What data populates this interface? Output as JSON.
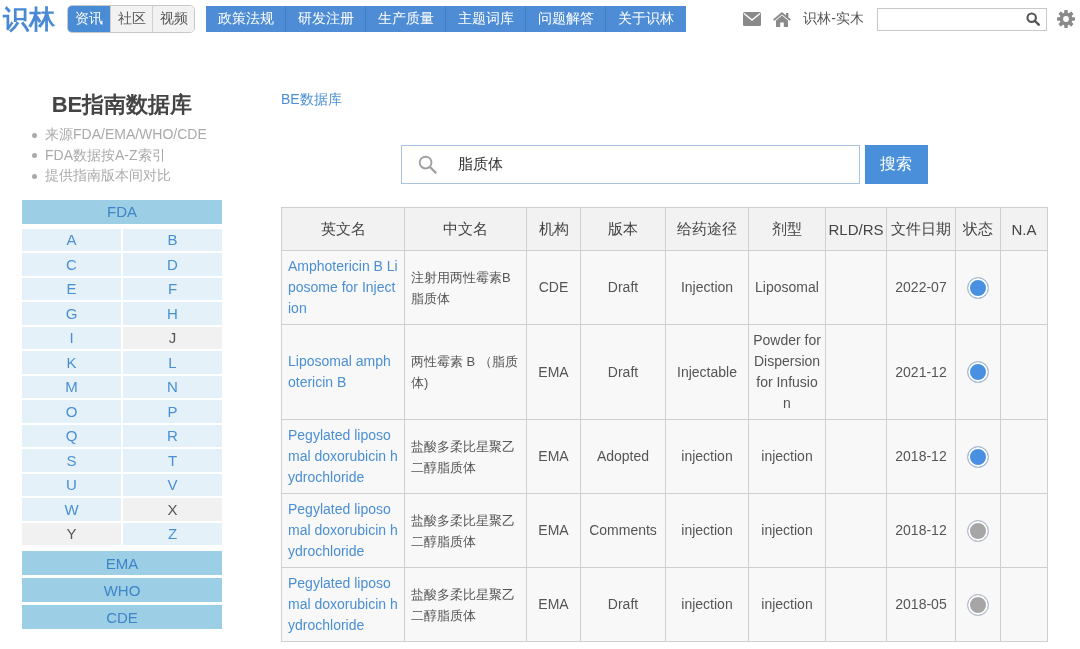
{
  "header": {
    "logo": "识林",
    "tabs": [
      {
        "label": "资讯",
        "selected": true
      },
      {
        "label": "社区",
        "selected": false
      },
      {
        "label": "视频",
        "selected": false
      }
    ],
    "nav": [
      "政策法规",
      "研发注册",
      "生产质量",
      "主题词库",
      "问题解答",
      "关于识林"
    ],
    "user": "识林-实木"
  },
  "sidebar": {
    "title": "BE指南数据库",
    "features": [
      "来源FDA/EMA/WHO/CDE",
      "FDA数据按A-Z索引",
      "提供指南版本间对比"
    ],
    "sources": [
      {
        "label": "FDA",
        "letters": [
          {
            "label": "A",
            "disabled": false
          },
          {
            "label": "B",
            "disabled": false
          },
          {
            "label": "C",
            "disabled": false
          },
          {
            "label": "D",
            "disabled": false
          },
          {
            "label": "E",
            "disabled": false
          },
          {
            "label": "F",
            "disabled": false
          },
          {
            "label": "G",
            "disabled": false
          },
          {
            "label": "H",
            "disabled": false
          },
          {
            "label": "I",
            "disabled": false
          },
          {
            "label": "J",
            "disabled": true
          },
          {
            "label": "K",
            "disabled": false
          },
          {
            "label": "L",
            "disabled": false
          },
          {
            "label": "M",
            "disabled": false
          },
          {
            "label": "N",
            "disabled": false
          },
          {
            "label": "O",
            "disabled": false
          },
          {
            "label": "P",
            "disabled": false
          },
          {
            "label": "Q",
            "disabled": false
          },
          {
            "label": "R",
            "disabled": false
          },
          {
            "label": "S",
            "disabled": false
          },
          {
            "label": "T",
            "disabled": false
          },
          {
            "label": "U",
            "disabled": false
          },
          {
            "label": "V",
            "disabled": false
          },
          {
            "label": "W",
            "disabled": false
          },
          {
            "label": "X",
            "disabled": true
          },
          {
            "label": "Y",
            "disabled": true
          },
          {
            "label": "Z",
            "disabled": false
          }
        ]
      },
      {
        "label": "EMA"
      },
      {
        "label": "WHO"
      },
      {
        "label": "CDE"
      }
    ]
  },
  "breadcrumb": "BE数据库",
  "search": {
    "value": "脂质体",
    "button": "搜索"
  },
  "table": {
    "columns": [
      "英文名",
      "中文名",
      "机构",
      "版本",
      "给药途径",
      "剂型",
      "RLD/RS",
      "文件日期",
      "状态",
      "N.A"
    ],
    "rows": [
      {
        "english": "Amphotericin B Liposome for Injection",
        "chinese": "注射用两性霉素B脂质体",
        "agency": "CDE",
        "version": "Draft",
        "route": "Injection",
        "form": "Liposomal",
        "date": "2022-07",
        "color": "#4a90e2"
      },
      {
        "english": "Liposomal amphotericin B",
        "chinese": "两性霉素 B （脂质体)",
        "agency": "EMA",
        "version": "Draft",
        "route": "Injectable",
        "form": "Powder for Dispersion for Infusion",
        "date": "2021-12",
        "color": "#4a90e2"
      },
      {
        "english": "Pegylated liposomal doxorubicin hydrochloride",
        "chinese": "盐酸多柔比星聚乙二醇脂质体",
        "agency": "EMA",
        "version": "Adopted",
        "route": "injection",
        "form": "injection",
        "date": "2018-12",
        "color": "#4a90e2"
      },
      {
        "english": "Pegylated liposomal doxorubicin hydrochloride",
        "chinese": "盐酸多柔比星聚乙二醇脂质体",
        "agency": "EMA",
        "version": "Comments",
        "route": "injection",
        "form": "injection",
        "date": "2018-12",
        "color": "#a6a6a6"
      },
      {
        "english": "Pegylated liposomal doxorubicin hydrochloride",
        "chinese": "盐酸多柔比星聚乙二醇脂质体",
        "agency": "EMA",
        "version": "Draft",
        "route": "injection",
        "form": "injection",
        "date": "2018-05",
        "color": "#a6a6a6"
      }
    ]
  }
}
